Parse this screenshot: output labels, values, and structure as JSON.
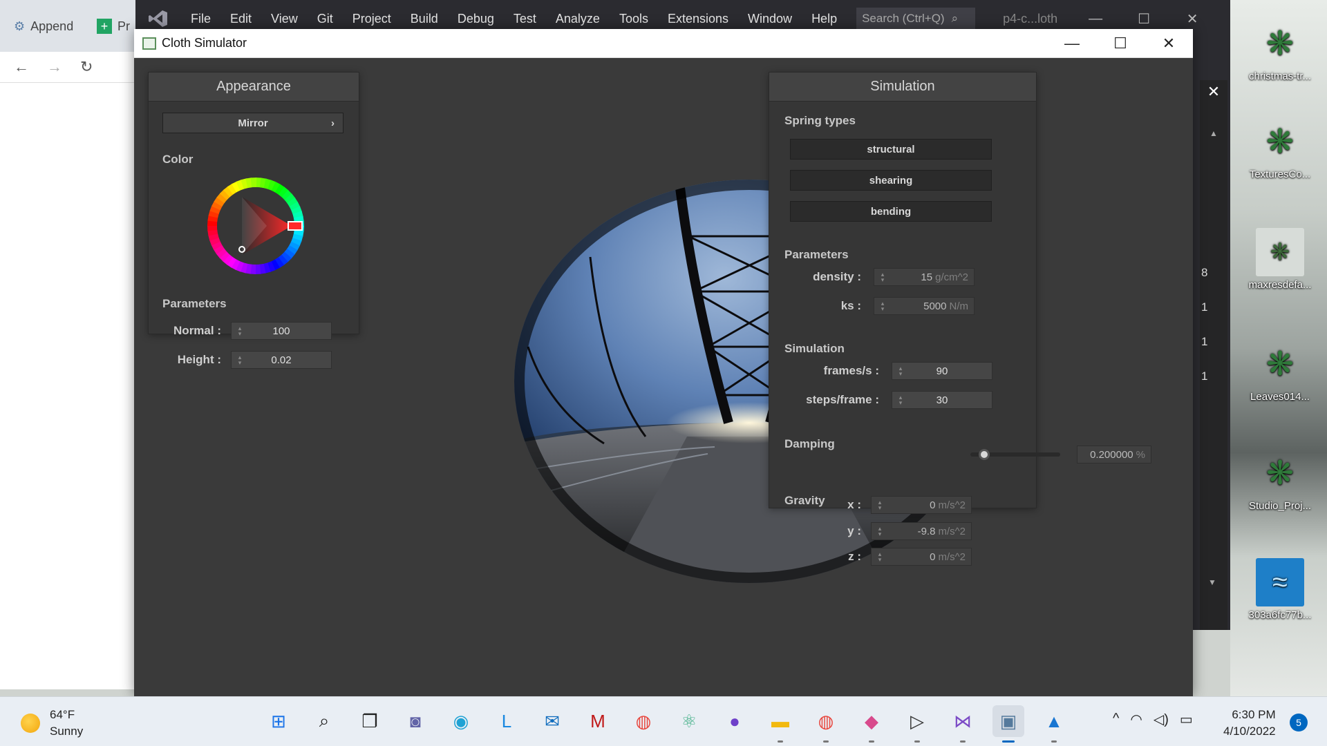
{
  "browser": {
    "tabs": [
      {
        "label": "Append",
        "icon": "settings-gear-icon"
      },
      {
        "label": "Pr",
        "icon": "sheets-icon"
      }
    ],
    "nav": {
      "back": "←",
      "forward": "→",
      "reload": "↻"
    }
  },
  "vs": {
    "menu": [
      "File",
      "Edit",
      "View",
      "Git",
      "Project",
      "Build",
      "Debug",
      "Test",
      "Analyze",
      "Tools",
      "Extensions",
      "Window",
      "Help"
    ],
    "search_placeholder": "Search (Ctrl+Q)",
    "project_name": "p4-c...loth",
    "side_numbers": [
      "8",
      "1",
      "1",
      "1"
    ]
  },
  "desktop_icons": [
    {
      "label": "christmas-tr...",
      "icon": "tree-icon"
    },
    {
      "label": "TexturesCo...",
      "icon": "tree-icon"
    },
    {
      "label": "maxresdefa...",
      "icon": "image-icon"
    },
    {
      "label": "Leaves014...",
      "icon": "tree-icon"
    },
    {
      "label": "Studio_Proj...",
      "icon": "tree-icon"
    },
    {
      "label": "303a6fc77b...",
      "icon": "album-icon"
    }
  ],
  "app": {
    "title": "Cloth Simulator",
    "controls": {
      "minimize": "—",
      "maximize": "☐",
      "close": "✕"
    },
    "appearance": {
      "header": "Appearance",
      "material_button": "Mirror",
      "material_chevron": "›",
      "color_label": "Color",
      "parameters_label": "Parameters",
      "normal_label": "Normal :",
      "normal_value": "100",
      "height_label": "Height :",
      "height_value": "0.02"
    },
    "simulation": {
      "header": "Simulation",
      "spring_types_label": "Spring types",
      "spring_types": [
        "structural",
        "shearing",
        "bending"
      ],
      "parameters_label": "Parameters",
      "density_label": "density :",
      "density_value": "15",
      "density_unit": "g/cm^2",
      "ks_label": "ks :",
      "ks_value": "5000",
      "ks_unit": "N/m",
      "simulation_label": "Simulation",
      "fps_label": "frames/s :",
      "fps_value": "90",
      "steps_label": "steps/frame :",
      "steps_value": "30",
      "damping_label": "Damping",
      "damping_value": "0.200000",
      "damping_unit": "%",
      "damping_level": 0.15,
      "gravity_label": "Gravity",
      "gx_label": "x :",
      "gx_value": "0",
      "gy_label": "y :",
      "gy_value": "-9.8",
      "gz_label": "z :",
      "gz_value": "0",
      "gravity_unit": "m/s^2"
    }
  },
  "taskbar": {
    "weather_temp": "64°F",
    "weather_desc": "Sunny",
    "apps": [
      {
        "name": "start-icon",
        "glyph": "⊞",
        "color": "#1a73e8",
        "pinned": false
      },
      {
        "name": "search-icon",
        "glyph": "⌕",
        "color": "#222",
        "pinned": false
      },
      {
        "name": "task-view-icon",
        "glyph": "❐",
        "color": "#222",
        "pinned": false
      },
      {
        "name": "teams-chat-icon",
        "glyph": "◙",
        "color": "#6264a7",
        "pinned": false
      },
      {
        "name": "edge-icon",
        "glyph": "◉",
        "color": "#1fa2d4",
        "pinned": false
      },
      {
        "name": "l-app-icon",
        "glyph": "L",
        "color": "#1a88e0",
        "pinned": false
      },
      {
        "name": "mail-icon",
        "glyph": "✉",
        "color": "#0f6cbd",
        "pinned": false
      },
      {
        "name": "mcafee-icon",
        "glyph": "M",
        "color": "#c01818",
        "pinned": false
      },
      {
        "name": "chrome-icon",
        "glyph": "◍",
        "color": "#e8453c",
        "pinned": false
      },
      {
        "name": "atom-icon",
        "glyph": "⚛",
        "color": "#43b087",
        "pinned": false
      },
      {
        "name": "github-icon",
        "glyph": "●",
        "color": "#6e40c9",
        "pinned": false
      },
      {
        "name": "file-explorer-icon",
        "glyph": "▬",
        "color": "#f2b90f",
        "pinned": true
      },
      {
        "name": "chrome-profile-icon",
        "glyph": "◍",
        "color": "#e8453c",
        "pinned": true
      },
      {
        "name": "git-kraken-icon",
        "glyph": "◆",
        "color": "#d84a8c",
        "pinned": true
      },
      {
        "name": "media-player-icon",
        "glyph": "▷",
        "color": "#333",
        "pinned": true
      },
      {
        "name": "visual-studio-icon",
        "glyph": "⋈",
        "color": "#7b4ac6",
        "pinned": true
      },
      {
        "name": "cloth-sim-icon",
        "glyph": "▣",
        "color": "#557a9c",
        "pinned": true,
        "active": true
      },
      {
        "name": "photos-icon",
        "glyph": "▲",
        "color": "#1976d2",
        "pinned": true
      }
    ],
    "tray_chevron": "^",
    "time": "6:30 PM",
    "date": "4/10/2022",
    "notifications": "5"
  }
}
